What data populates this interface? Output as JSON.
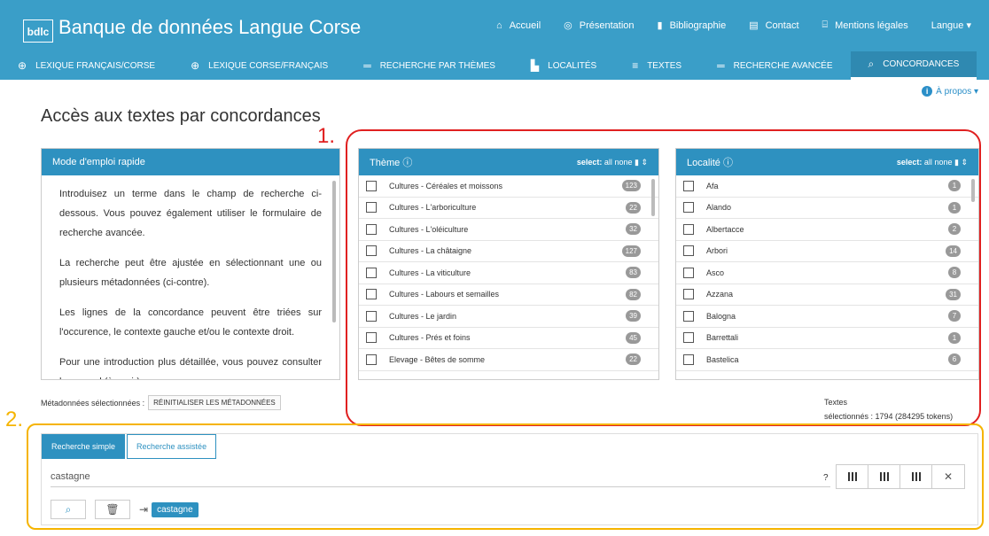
{
  "header": {
    "logo": "bdlc",
    "title": "Banque de données Langue Corse",
    "nav": [
      {
        "icon": "home-icon",
        "label": "Accueil"
      },
      {
        "icon": "compass-icon",
        "label": "Présentation"
      },
      {
        "icon": "book-icon",
        "label": "Bibliographie"
      },
      {
        "icon": "contact-card-icon",
        "label": "Contact"
      },
      {
        "icon": "bank-icon",
        "label": "Mentions légales"
      },
      {
        "icon": "",
        "label": "Langue ▾"
      }
    ]
  },
  "tabs": [
    {
      "icon": "globe-icon",
      "label": "Lexique français/corse"
    },
    {
      "icon": "globe-icon",
      "label": "Lexique corse/français"
    },
    {
      "icon": "lines-icon",
      "label": "Recherche par thèmes"
    },
    {
      "icon": "building-icon",
      "label": "Localités"
    },
    {
      "icon": "text-icon",
      "label": "Textes"
    },
    {
      "icon": "lines-icon",
      "label": "Recherche avancée"
    },
    {
      "icon": "search-icon",
      "label": "Concordances",
      "active": true
    }
  ],
  "apropos": "À propos ▾",
  "page_title": "Accès aux textes par concordances",
  "annotations": {
    "one": "1.",
    "two": "2."
  },
  "mode": {
    "title": "Mode d'emploi rapide",
    "paragraphs": [
      "Introduisez un terme dans le champ de recherche ci-dessous. Vous pouvez également utiliser le formulaire de recherche avancée.",
      "La recherche peut être ajustée en sélectionnant une ou plusieurs métadonnées (ci-contre).",
      "Les lignes de la concordance peuvent être triées sur l'occurence, le contexte gauche et/ou le contexte droit.",
      "Pour une introduction plus détaillée, vous pouvez consulter le manuel (à venir)."
    ]
  },
  "theme": {
    "title": "Thème",
    "select_label": "select:",
    "all": "all",
    "none": "none",
    "items": [
      {
        "label": "Cultures - Céréales et moissons",
        "count": "123"
      },
      {
        "label": "Cultures - L'arboriculture",
        "count": "22"
      },
      {
        "label": "Cultures - L'oléiculture",
        "count": "32"
      },
      {
        "label": "Cultures - La châtaigne",
        "count": "127"
      },
      {
        "label": "Cultures - La viticulture",
        "count": "83"
      },
      {
        "label": "Cultures - Labours et semailles",
        "count": "82"
      },
      {
        "label": "Cultures - Le jardin",
        "count": "39"
      },
      {
        "label": "Cultures - Prés et foins",
        "count": "45"
      },
      {
        "label": "Elevage - Bêtes de somme",
        "count": "22"
      }
    ]
  },
  "loc": {
    "title": "Localité",
    "select_label": "select:",
    "all": "all",
    "none": "none",
    "items": [
      {
        "label": "Afa",
        "count": "1"
      },
      {
        "label": "Alando",
        "count": "1"
      },
      {
        "label": "Albertacce",
        "count": "2"
      },
      {
        "label": "Arbori",
        "count": "14"
      },
      {
        "label": "Asco",
        "count": "8"
      },
      {
        "label": "Azzana",
        "count": "31"
      },
      {
        "label": "Balogna",
        "count": "7"
      },
      {
        "label": "Barrettali",
        "count": "1"
      },
      {
        "label": "Bastelica",
        "count": "6"
      }
    ]
  },
  "meta": {
    "label": "Métadonnées sélectionnées :",
    "reset": "RÉINITIALISER LES MÉTADONNÉES"
  },
  "textes": {
    "line1": "Textes",
    "line2": "sélectionnés : 1794 (284295 tokens)"
  },
  "search": {
    "tab_simple": "Recherche simple",
    "tab_assist": "Recherche assistée",
    "value": "castagne",
    "help": "?",
    "clear": "✕",
    "chip": "castagne"
  }
}
